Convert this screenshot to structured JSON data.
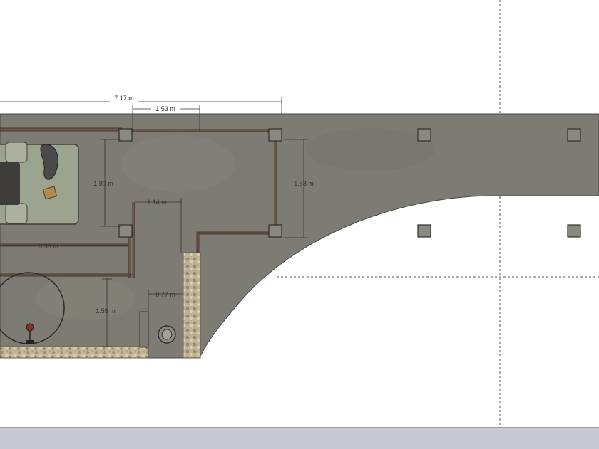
{
  "app": "SketchUp floor plan viewport",
  "dimensions": {
    "overall_width": "7.17 m",
    "top_segment": "1.53 m",
    "bedroom_depth": "1.90 m",
    "right_room_depth": "1.58 m",
    "inner_offset": "1.14 m",
    "bedroom_width": "3.36 m",
    "lower_depth": "1.55 m",
    "small_gap": "0.77 m"
  },
  "colors": {
    "floor": "#7d7b73",
    "wall": "#5a4a3e",
    "column": "#8a8880",
    "bed_frame": "#9ca38f",
    "stone": "#b8a98a",
    "guide_line": "#555555",
    "status_bar": "#c9c9d4"
  },
  "icons": {
    "bed": "bed-icon",
    "rug": "round-rug-icon",
    "lamp": "floor-lamp-icon",
    "toilet": "round-fixture-icon"
  }
}
